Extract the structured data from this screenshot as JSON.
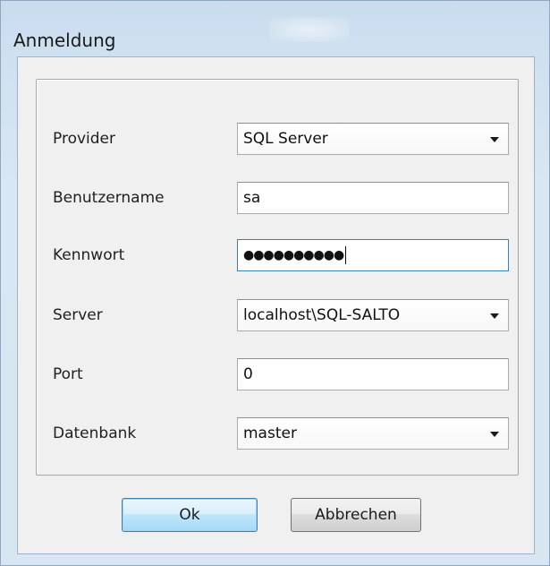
{
  "window": {
    "title": "Anmeldung"
  },
  "form": {
    "provider": {
      "label": "Provider",
      "value": "SQL Server"
    },
    "username": {
      "label": "Benutzername",
      "value": "sa"
    },
    "password": {
      "label": "Kennwort",
      "value": "●●●●●●●●●●"
    },
    "server": {
      "label": "Server",
      "value": "localhost\\SQL-SALTO"
    },
    "port": {
      "label": "Port",
      "value": "0"
    },
    "database": {
      "label": "Datenbank",
      "value": "master"
    }
  },
  "buttons": {
    "ok": "Ok",
    "cancel": "Abbrechen"
  },
  "colors": {
    "accent": "#3c7fb1",
    "window_frame": "#c9dcee",
    "client_bg": "#f0f0f0"
  }
}
